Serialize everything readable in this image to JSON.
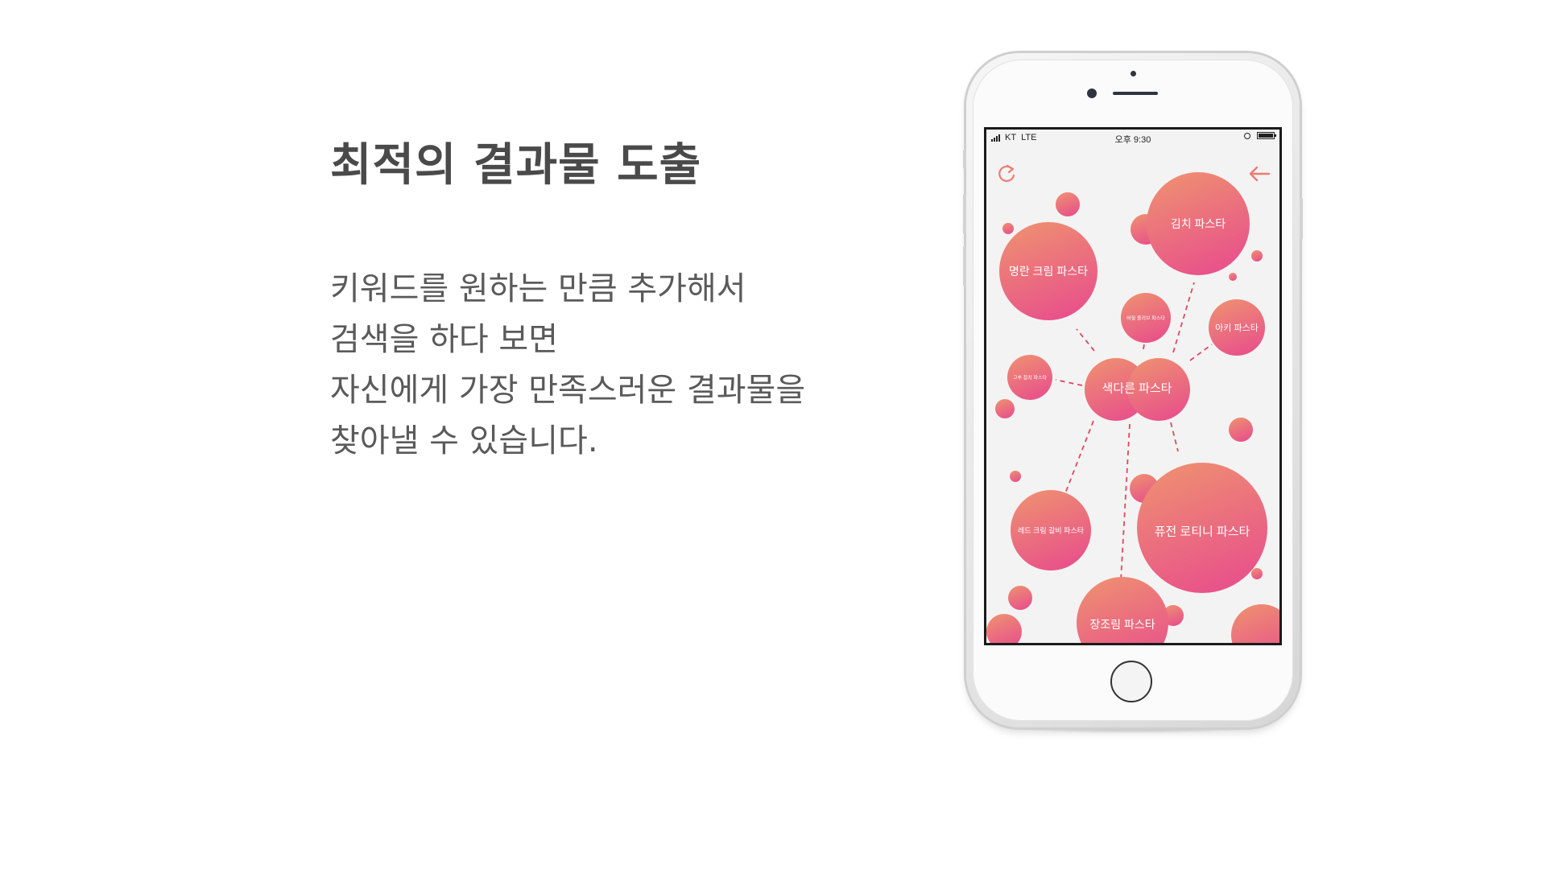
{
  "slide": {
    "title": "최적의 결과물 도출",
    "description_lines": [
      "키워드를 원하는 만큼 추가해서",
      "검색을 하다 보면",
      "자신에게 가장 만족스러운 결과물을",
      "찾아낼 수 있습니다."
    ]
  },
  "phone": {
    "status_bar": {
      "carrier": "KT",
      "network": "LTE",
      "time": "오후 9:30"
    },
    "refresh_icon": "refresh-icon",
    "back_icon": "back-arrow-icon",
    "accent_color": "#ec7b73",
    "bubble_gradient": [
      "#ee8a72",
      "#e9558a"
    ],
    "center_keyword": "색다른  파스타",
    "results": [
      "김치 파스타",
      "명란 크림 파스타",
      "바질 올리브 파스타",
      "아키 파스타",
      "고추 참치 파스타",
      "레드 크림 갈비 파스타",
      "퓨전 로티니 파스타",
      "장조림 파스타"
    ]
  }
}
